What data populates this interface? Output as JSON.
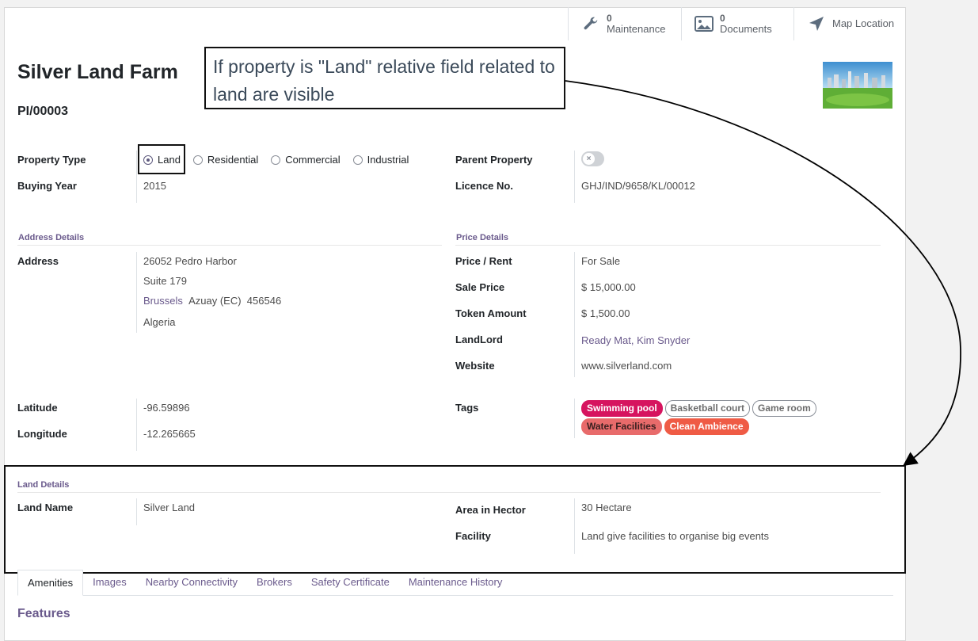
{
  "smart_buttons": {
    "maintenance": {
      "count": "0",
      "label": "Maintenance"
    },
    "documents": {
      "count": "0",
      "label": "Documents"
    },
    "map": {
      "label": "Map Location"
    }
  },
  "record": {
    "title": "Silver Land Farm",
    "ref": "PI/00003"
  },
  "callout": {
    "text": "If property is \"Land\" relative field related to land are visible"
  },
  "property_type": {
    "label": "Property Type",
    "options": [
      "Land",
      "Residential",
      "Commercial",
      "Industrial"
    ],
    "selected": "Land"
  },
  "buying_year": {
    "label": "Buying Year",
    "value": "2015"
  },
  "parent_property": {
    "label": "Parent Property"
  },
  "licence": {
    "label": "Licence No.",
    "value": "GHJ/IND/9658/KL/00012"
  },
  "address_section": {
    "title": "Address Details",
    "label": "Address",
    "street": "26052 Pedro Harbor",
    "street2": "Suite 179",
    "city": "Brussels",
    "state": "Azuay (EC)",
    "zip": "456546",
    "country": "Algeria"
  },
  "price_section": {
    "title": "Price Details",
    "price_rent": {
      "label": "Price / Rent",
      "value": "For Sale"
    },
    "sale_price": {
      "label": "Sale Price",
      "value": "$ 15,000.00"
    },
    "token_amount": {
      "label": "Token Amount",
      "value": "$ 1,500.00"
    },
    "landlord": {
      "label": "LandLord",
      "value": "Ready Mat, Kim Snyder"
    },
    "website": {
      "label": "Website",
      "value": "www.silverland.com"
    }
  },
  "latitude": {
    "label": "Latitude",
    "value": "-96.59896"
  },
  "longitude": {
    "label": "Longitude",
    "value": "-12.265665"
  },
  "tags": {
    "label": "Tags",
    "items": [
      {
        "text": "Swimming pool",
        "bg": "#d6145f",
        "fg": "#ffffff",
        "border": "#d6145f"
      },
      {
        "text": "Basketball court",
        "bg": "#ffffff",
        "fg": "#6c6c6c",
        "border": "#8a8f98"
      },
      {
        "text": "Game room",
        "bg": "#ffffff",
        "fg": "#6c6c6c",
        "border": "#8a8f98"
      },
      {
        "text": "Water Facilities",
        "bg": "#e86b6b",
        "fg": "#3a2020",
        "border": "#e86b6b"
      },
      {
        "text": "Clean Ambience",
        "bg": "#ef5b45",
        "fg": "#ffffff",
        "border": "#ef5b45"
      }
    ]
  },
  "land_section": {
    "title": "Land Details",
    "land_name": {
      "label": "Land Name",
      "value": "Silver Land"
    },
    "area": {
      "label": "Area in Hector",
      "value": "30 Hectare"
    },
    "facility": {
      "label": "Facility",
      "value": "Land give facilities to organise big events"
    }
  },
  "tabs": [
    "Amenities",
    "Images",
    "Nearby Connectivity",
    "Brokers",
    "Safety Certificate",
    "Maintenance History"
  ],
  "active_tab": "Amenities",
  "features_heading": "Features",
  "colors": {
    "accent": "#6a5a8c",
    "text": "#212529"
  }
}
